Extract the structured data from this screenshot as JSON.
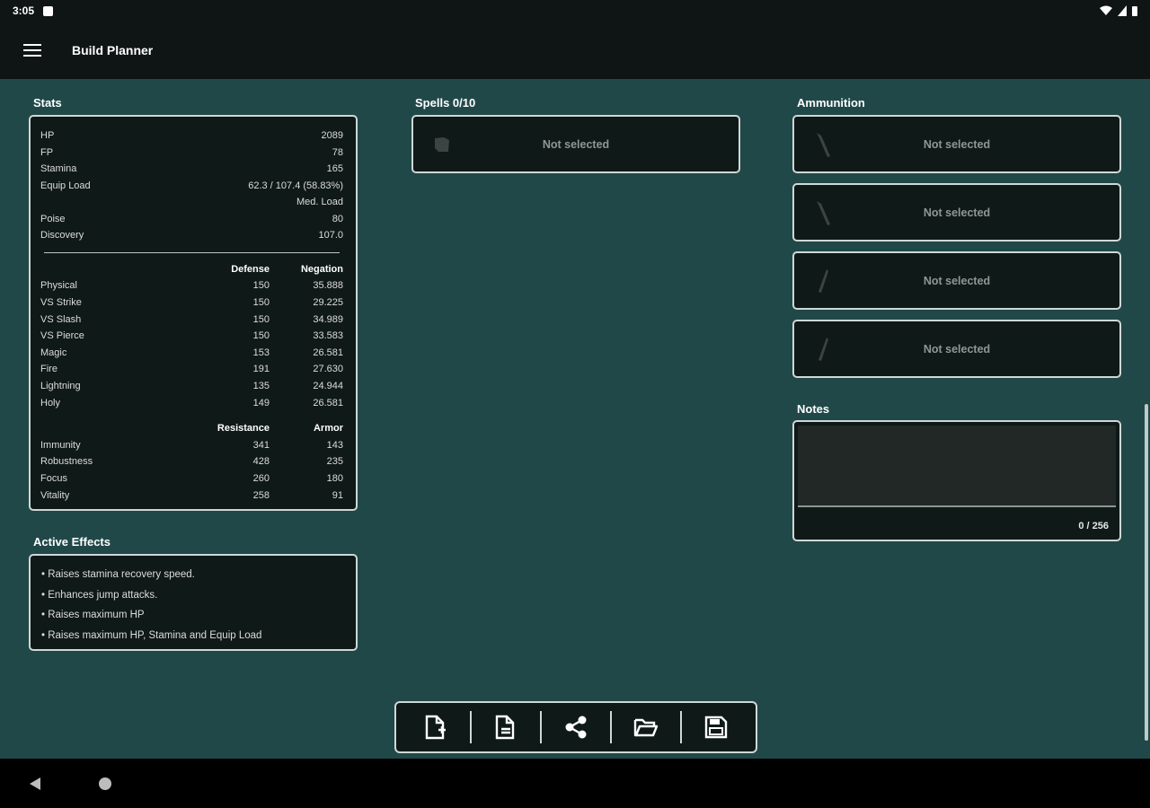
{
  "status": {
    "time": "3:05"
  },
  "app": {
    "title": "Build Planner"
  },
  "stats": {
    "label": "Stats",
    "basic": [
      {
        "name": "HP",
        "value": "2089"
      },
      {
        "name": "FP",
        "value": "78"
      },
      {
        "name": "Stamina",
        "value": "165"
      },
      {
        "name": "Equip Load",
        "value": "62.3 / 107.4 (58.83%)"
      },
      {
        "name": "",
        "value": "Med. Load"
      },
      {
        "name": "Poise",
        "value": "80"
      },
      {
        "name": "Discovery",
        "value": "107.0"
      }
    ],
    "defense_header": {
      "col1": "Defense",
      "col2": "Negation"
    },
    "defense": [
      {
        "name": "Physical",
        "a": "150",
        "b": "35.888"
      },
      {
        "name": "VS Strike",
        "a": "150",
        "b": "29.225"
      },
      {
        "name": "VS Slash",
        "a": "150",
        "b": "34.989"
      },
      {
        "name": "VS Pierce",
        "a": "150",
        "b": "33.583"
      },
      {
        "name": "Magic",
        "a": "153",
        "b": "26.581"
      },
      {
        "name": "Fire",
        "a": "191",
        "b": "27.630"
      },
      {
        "name": "Lightning",
        "a": "135",
        "b": "24.944"
      },
      {
        "name": "Holy",
        "a": "149",
        "b": "26.581"
      }
    ],
    "resist_header": {
      "col1": "Resistance",
      "col2": "Armor"
    },
    "resist": [
      {
        "name": "Immunity",
        "a": "341",
        "b": "143"
      },
      {
        "name": "Robustness",
        "a": "428",
        "b": "235"
      },
      {
        "name": "Focus",
        "a": "260",
        "b": "180"
      },
      {
        "name": "Vitality",
        "a": "258",
        "b": "91"
      }
    ]
  },
  "effects": {
    "label": "Active Effects",
    "items": [
      "• Raises stamina recovery speed.",
      "• Enhances jump attacks.",
      "• Raises maximum HP",
      "• Raises maximum HP, Stamina and Equip Load"
    ]
  },
  "spells": {
    "label": "Spells 0/10",
    "slot_text": "Not selected"
  },
  "ammunition": {
    "label": "Ammunition",
    "slots": [
      "Not selected",
      "Not selected",
      "Not selected",
      "Not selected"
    ]
  },
  "notes": {
    "label": "Notes",
    "counter": "0 / 256"
  },
  "colors": {
    "background": "#214848",
    "card": "#0f1918",
    "bar": "#0e1514",
    "border": "#cfd8d6"
  }
}
